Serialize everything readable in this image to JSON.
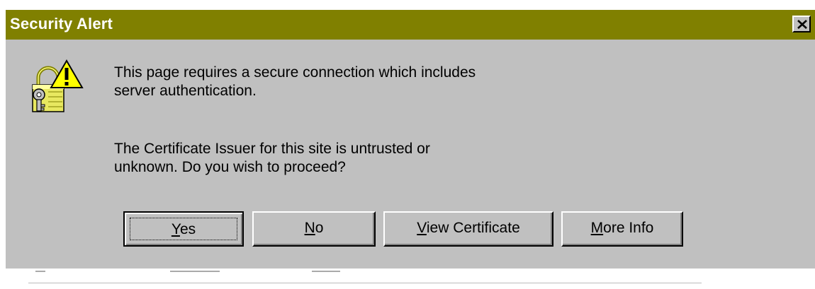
{
  "dialog": {
    "title": "Security Alert",
    "close_icon": "close-icon",
    "alert_icon": "security-warning-icon",
    "message_line1": "This page requires a secure connection which includes",
    "message_line2": "server authentication.",
    "message_line3": "The Certificate Issuer for this site is untrusted or",
    "message_line4": "unknown.  Do you wish to proceed?",
    "buttons": {
      "yes": {
        "mnemonic": "Y",
        "rest": "es"
      },
      "no": {
        "mnemonic": "N",
        "rest": "o"
      },
      "view_certificate": {
        "mnemonic": "V",
        "rest": "iew Certificate"
      },
      "more_info": {
        "mnemonic": "M",
        "rest": "ore Info"
      }
    }
  },
  "colors": {
    "titlebar": "#808000",
    "dialog_bg": "#c0c0c0",
    "warning_yellow": "#ffff00"
  }
}
